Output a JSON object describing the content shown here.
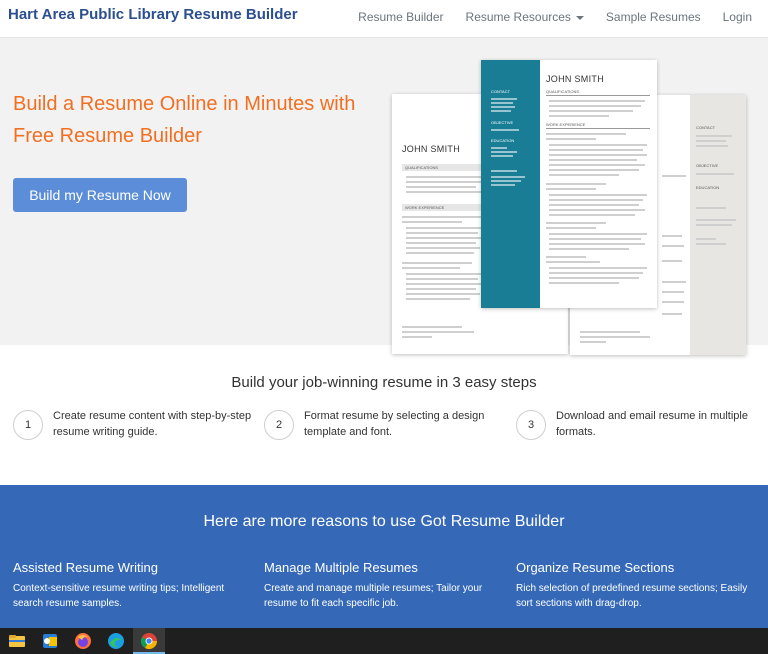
{
  "navbar": {
    "brand": "Hart Area Public Library Resume Builder",
    "links": [
      "Resume Builder",
      "Resume Resources",
      "Sample Resumes",
      "Login"
    ]
  },
  "hero": {
    "title": "Build a Resume Online in Minutes with Free Resume Builder",
    "cta_label": "Build my Resume Now",
    "resume_name": "JOHN SMITH",
    "front_sections": [
      "CONTACT",
      "OBJECTIVE",
      "EDUCATION",
      "QUALIFICATIONS",
      "WORK EXPERIENCE"
    ],
    "back_sections": [
      "QUALIFICATIONS",
      "WORK EXPERIENCE"
    ],
    "right_sections": [
      "CONTACT",
      "OBJECTIVE",
      "EDUCATION"
    ]
  },
  "steps": {
    "title": "Build your job-winning resume in 3 easy steps",
    "items": [
      {
        "num": "1",
        "text": "Create resume content with step-by-step resume writing guide."
      },
      {
        "num": "2",
        "text": "Format resume by selecting a design template and font."
      },
      {
        "num": "3",
        "text": "Download and email resume in multiple formats."
      }
    ]
  },
  "reasons": {
    "title": "Here are more reasons to use Got Resume Builder",
    "items": [
      {
        "title": "Assisted Resume Writing",
        "text": "Context-sensitive resume writing tips; Intelligent search resume samples."
      },
      {
        "title": "Manage Multiple Resumes",
        "text": "Create and manage multiple resumes; Tailor your resume to fit each specific job."
      },
      {
        "title": "Organize Resume Sections",
        "text": "Rich selection of predefined resume sections; Easily sort sections with drag-drop."
      }
    ]
  },
  "taskbar": {
    "icons": [
      "file-explorer-icon",
      "outlook-icon",
      "firefox-icon",
      "edge-icon",
      "chrome-icon"
    ]
  },
  "colors": {
    "brand": "#2c4f8f",
    "accent_orange": "#f26f21",
    "cta_blue": "#5b8dd9",
    "reasons_bg": "#3569b8",
    "resume_teal": "#1a7d96"
  }
}
